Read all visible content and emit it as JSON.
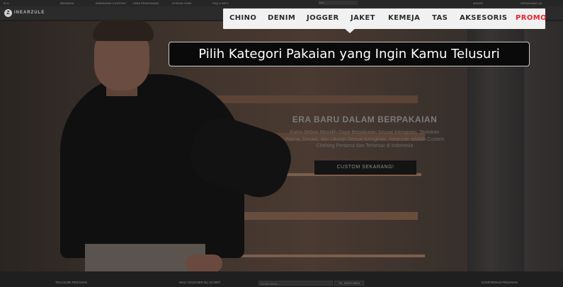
{
  "site": {
    "brand": "INEARZULE",
    "logo_letter": "Z",
    "topbar": {
      "left": "ID ▾",
      "links": [
        "BERANDA",
        "BIMBINGAN CUSTOM?",
        "CARA PEMESANAN",
        "KONTAK KAMI",
        "FAQ & INFO"
      ],
      "search_placeholder": "Cari...",
      "account": "MASUK",
      "cart": "KERANJANG (0)"
    }
  },
  "menu": {
    "items": [
      "CHINO",
      "DENIM",
      "JOGGER",
      "JAKET",
      "KEMEJA",
      "TAS",
      "AKSESORIS",
      "PROMO"
    ],
    "promo_color": "#e5232e"
  },
  "callout": {
    "text": "Pilih Kategori Pakaian yang Ingin Kamu Telusuri"
  },
  "hero": {
    "title": "ERA BARU DALAM BERPAKAIAN",
    "description": "Kamu Bebas Memilih Gaya Berpakaian Sesuai Keinginan. Tentukan Warna, Desain, dan Ukuran Sesuai Keinginan. Inearzule adalah Custom Clothing Pertama dan Terbesar di Indonesia",
    "cta": "CUSTOM SEKARANG!"
  },
  "footer": {
    "left": "TELUSURI PESANAN",
    "voucher_label": "MAU VOUCHER Rp 10.000?",
    "voucher_placeholder": "Email kamu...",
    "voucher_button": "YA, SAYA MAU",
    "right": "KONFIRMASI PESANAN"
  }
}
